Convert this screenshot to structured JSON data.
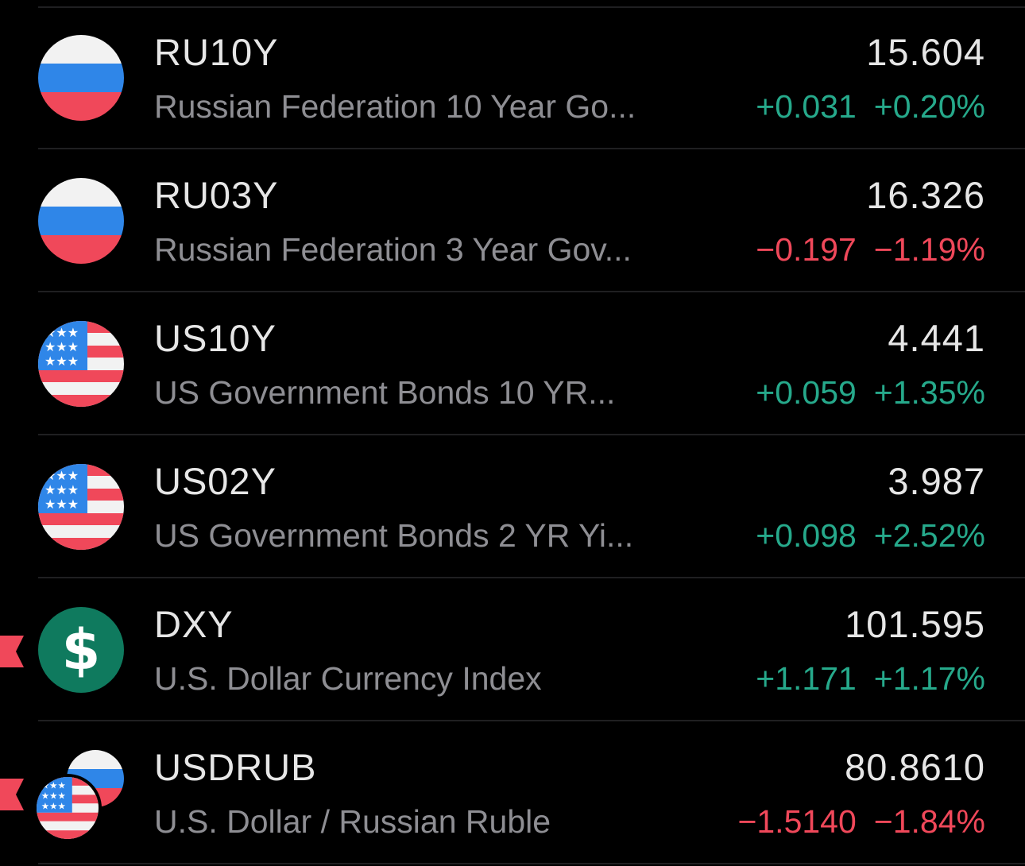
{
  "colors": {
    "background": "#000000",
    "primary_text": "#e6e6e6",
    "secondary_text": "#8e8e93",
    "positive": "#26a98b",
    "negative": "#f0485a",
    "separator": "#1f1f21",
    "flag_tag": "#f0485a"
  },
  "rows": [
    {
      "symbol": "RU10Y",
      "name": "Russian Federation 10 Year Go...",
      "price": "15.604",
      "change": "+0.031",
      "change_pct": "+0.20%",
      "direction": "up",
      "icon": "russia-flag-icon",
      "flagged": false
    },
    {
      "symbol": "RU03Y",
      "name": "Russian Federation 3 Year Gov...",
      "price": "16.326",
      "change": "−0.197",
      "change_pct": "−1.19%",
      "direction": "down",
      "icon": "russia-flag-icon",
      "flagged": false
    },
    {
      "symbol": "US10Y",
      "name": "US Government Bonds 10 YR...",
      "price": "4.441",
      "change": "+0.059",
      "change_pct": "+1.35%",
      "direction": "up",
      "icon": "usa-flag-icon",
      "flagged": false
    },
    {
      "symbol": "US02Y",
      "name": "US Government Bonds 2 YR Yi...",
      "price": "3.987",
      "change": "+0.098",
      "change_pct": "+2.52%",
      "direction": "up",
      "icon": "usa-flag-icon",
      "flagged": false
    },
    {
      "symbol": "DXY",
      "name": "U.S. Dollar Currency Index",
      "price": "101.595",
      "change": "+1.171",
      "change_pct": "+1.17%",
      "direction": "up",
      "icon": "dollar-sign-icon",
      "flagged": true
    },
    {
      "symbol": "USDRUB",
      "name": "U.S. Dollar / Russian Ruble",
      "price": "80.8610",
      "change": "−1.5140",
      "change_pct": "−1.84%",
      "direction": "down",
      "icon": "usd-rub-pair-icon",
      "flagged": true
    }
  ]
}
